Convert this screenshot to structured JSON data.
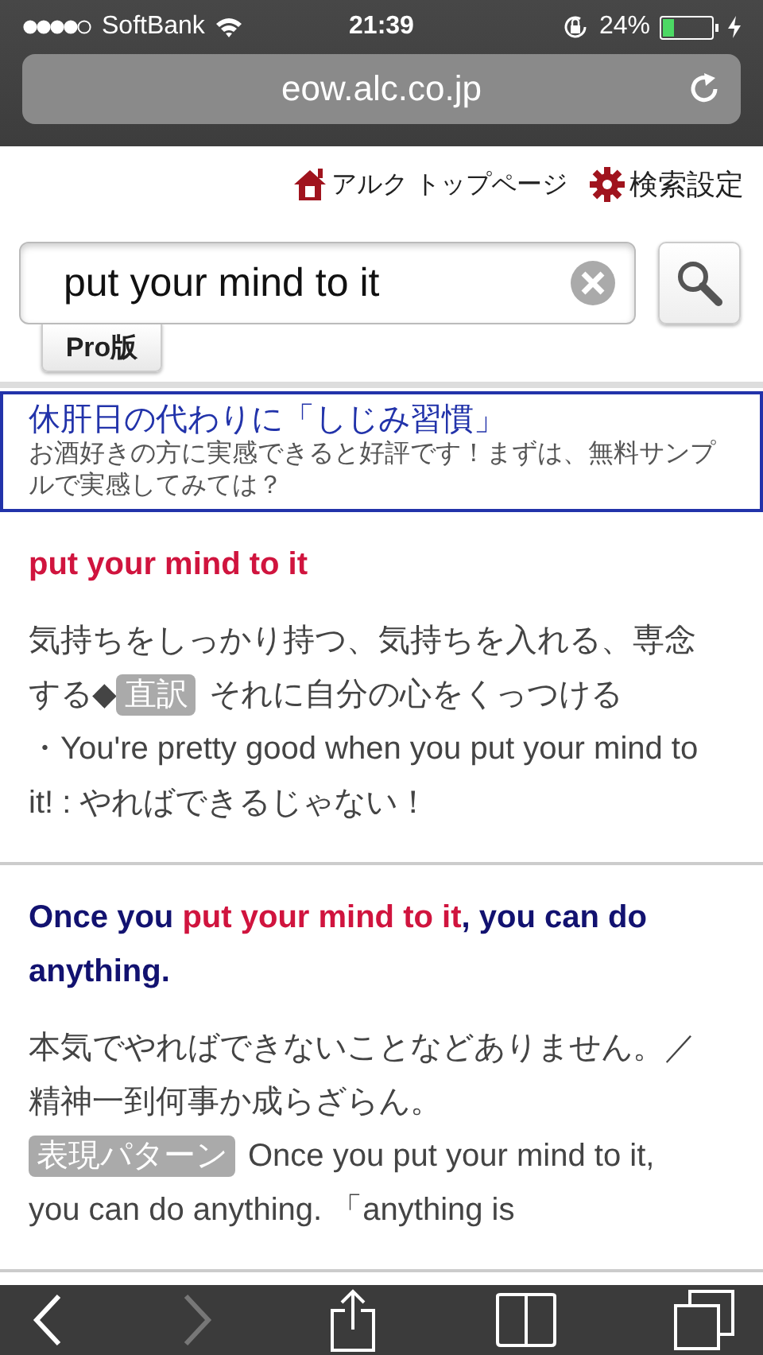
{
  "status_bar": {
    "carrier": "SoftBank",
    "time": "21:39",
    "battery_text": "24%",
    "battery": {
      "level": 0.24,
      "charging": true
    }
  },
  "address_bar": {
    "url": "eow.alc.co.jp"
  },
  "header_links": [
    {
      "kind": "home",
      "label": "アルク トップページ"
    },
    {
      "kind": "settings",
      "label": "検索設定"
    }
  ],
  "search": {
    "value": "put your mind to it",
    "pro_label": "Pro版"
  },
  "ad": {
    "title": "休肝日の代わりに「しじみ習慣」",
    "text": "お酒好きの方に実感できると好評です！まずは、無料サンプルで実感してみては？"
  },
  "entries": [
    {
      "heading": [
        {
          "text": "put your mind to it",
          "highlight": true
        }
      ],
      "lines": [
        [
          {
            "kind": "text",
            "text": "気持ちをしっかり持つ、気持ちを入れる、専念する◆"
          },
          {
            "kind": "label",
            "text": "直訳"
          },
          {
            "kind": "text",
            "text": "それに自分の心をくっつける"
          }
        ],
        [
          {
            "kind": "text",
            "text": "・You're pretty good when you put your mind to it! : やればできるじゃない！"
          }
        ]
      ]
    },
    {
      "heading": [
        {
          "text": "Once you ",
          "highlight": false
        },
        {
          "text": "put your mind to it",
          "highlight": true
        },
        {
          "text": ", you can do anything.",
          "highlight": false
        }
      ],
      "lines": [
        [
          {
            "kind": "text",
            "text": "本気でやればできないことなどありません。／精神一到何事か成らざらん。"
          }
        ],
        [
          {
            "kind": "label",
            "text": "表現パターン"
          },
          {
            "kind": "text",
            "text": "Once you put your mind to it, you can do anything. 「anything is"
          }
        ]
      ]
    }
  ],
  "toolbar": [
    {
      "kind": "back",
      "disabled": false
    },
    {
      "kind": "forward",
      "disabled": true
    },
    {
      "kind": "share",
      "disabled": false
    },
    {
      "kind": "bookmarks",
      "disabled": false
    },
    {
      "kind": "tabs",
      "disabled": false
    }
  ]
}
